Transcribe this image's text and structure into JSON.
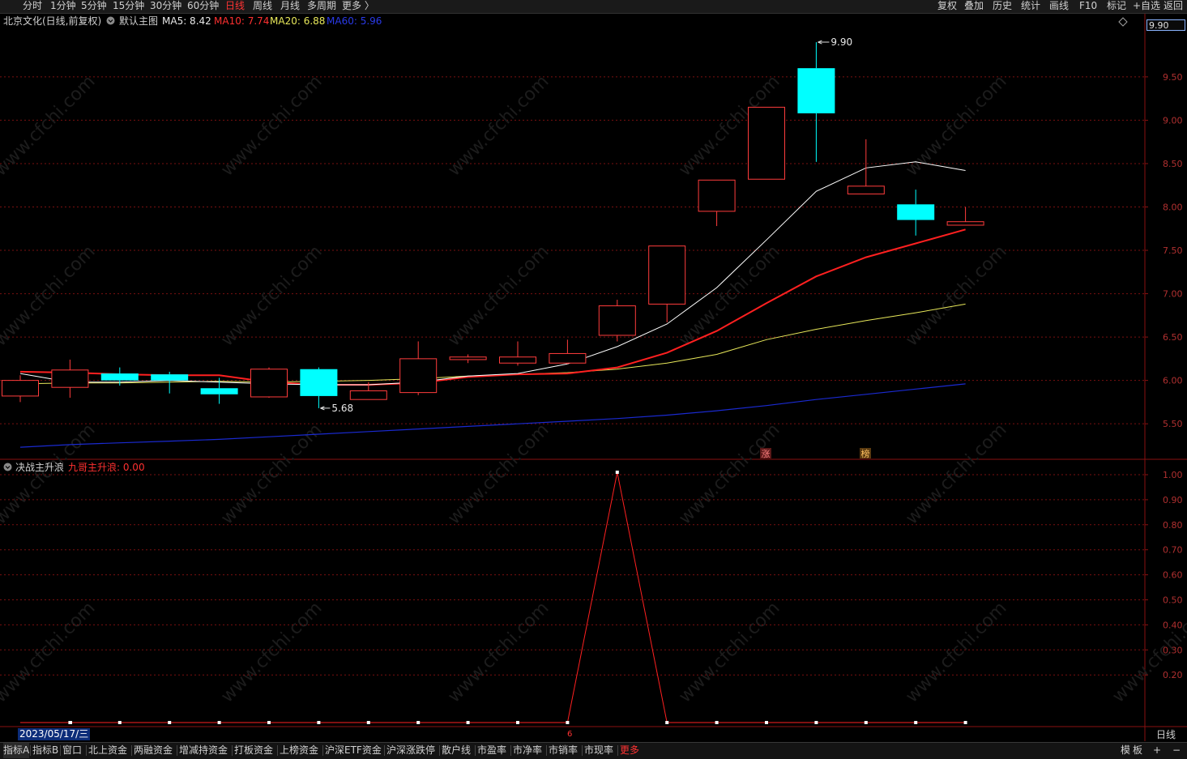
{
  "topbar": {
    "periods": [
      "分时",
      "1分钟",
      "5分钟",
      "15分钟",
      "30分钟",
      "60分钟",
      "日线",
      "周线",
      "月线",
      "多周期",
      "更多 〉"
    ],
    "active_period": "日线",
    "tools": [
      "复权",
      "叠加",
      "历史",
      "统计",
      "画线",
      "F10",
      "标记",
      "+自选",
      "返回"
    ]
  },
  "main_chart": {
    "title": "北京文化(日线,前复权)",
    "template": "默认主图",
    "ma5": "MA5: 8.42",
    "ma10": "MA10: 7.74",
    "ma20": "MA20: 6.88",
    "ma60": "MA60: 5.96",
    "current_price_tag": "9.90",
    "high_label": "9.90",
    "low_label": "5.68",
    "marker_zhang": "涨",
    "marker_bang": "榜",
    "y_ticks": [
      "9.50",
      "9.00",
      "8.50",
      "8.00",
      "7.50",
      "7.00",
      "6.50",
      "6.00",
      "5.50"
    ]
  },
  "indicator": {
    "name": "决战主升浪",
    "value_label": "九哥主升浪: 0.00",
    "y_ticks": [
      "1.00",
      "0.90",
      "0.80",
      "0.70",
      "0.60",
      "0.50",
      "0.40",
      "0.30",
      "0.20"
    ]
  },
  "footer": {
    "date_cursor": "2023/05/17/三",
    "date_marker": "6",
    "period_label": "日线"
  },
  "bottom_tabs": [
    "指标A",
    "指标B",
    "窗口",
    "北上资金",
    "两融资金",
    "增减持资金",
    "打板资金",
    "上榜资金",
    "沪深ETF资金",
    "沪深涨跌停",
    "散户线",
    "市盈率",
    "市净率",
    "市销率",
    "市现率",
    "更多"
  ],
  "bottom_right": [
    "模",
    "板",
    "+",
    "−"
  ],
  "watermark": "www.cfchi.com",
  "colors": {
    "up": "#ff3c3c",
    "down": "#00ffff",
    "ma5": "#ffffff",
    "ma10": "#ff2020",
    "ma20": "#e8e85a",
    "ma60": "#1a2ad0",
    "grid": "#7a1010"
  },
  "chart_data": {
    "type": "candlestick",
    "title": "北京文化(日线,前复权)",
    "ylim": [
      5.1,
      10.05
    ],
    "candles": [
      {
        "open": 5.82,
        "close": 6.0,
        "high": 6.06,
        "low": 5.75
      },
      {
        "open": 5.92,
        "close": 6.12,
        "high": 6.24,
        "low": 5.8
      },
      {
        "open": 6.08,
        "close": 6.0,
        "high": 6.15,
        "low": 5.94
      },
      {
        "open": 6.07,
        "close": 6.0,
        "high": 6.1,
        "low": 5.85
      },
      {
        "open": 5.91,
        "close": 5.84,
        "high": 6.03,
        "low": 5.73
      },
      {
        "open": 5.81,
        "close": 6.13,
        "high": 6.15,
        "low": 5.8
      },
      {
        "open": 6.13,
        "close": 5.82,
        "high": 6.15,
        "low": 5.68
      },
      {
        "open": 5.78,
        "close": 5.88,
        "high": 5.98,
        "low": 5.78
      },
      {
        "open": 5.86,
        "close": 6.25,
        "high": 6.45,
        "low": 5.83
      },
      {
        "open": 6.24,
        "close": 6.27,
        "high": 6.3,
        "low": 6.2
      },
      {
        "open": 6.2,
        "close": 6.27,
        "high": 6.45,
        "low": 6.17
      },
      {
        "open": 6.2,
        "close": 6.31,
        "high": 6.47,
        "low": 6.19
      },
      {
        "open": 6.52,
        "close": 6.86,
        "high": 6.93,
        "low": 6.45
      },
      {
        "open": 6.88,
        "close": 7.55,
        "high": 7.55,
        "low": 6.67
      },
      {
        "open": 7.95,
        "close": 8.31,
        "high": 8.31,
        "low": 7.78
      },
      {
        "open": 8.32,
        "close": 9.15,
        "high": 9.15,
        "low": 8.32
      },
      {
        "open": 9.6,
        "close": 9.08,
        "high": 9.9,
        "low": 8.52
      },
      {
        "open": 8.15,
        "close": 8.24,
        "high": 8.78,
        "low": 8.15
      },
      {
        "open": 8.03,
        "close": 7.85,
        "high": 8.2,
        "low": 7.67
      },
      {
        "open": 7.79,
        "close": 7.83,
        "high": 8.0,
        "low": 7.79
      }
    ],
    "ma5": [
      6.08,
      5.98,
      5.98,
      6.0,
      5.98,
      5.96,
      5.95,
      5.95,
      5.98,
      6.05,
      6.08,
      6.19,
      6.39,
      6.65,
      7.07,
      7.62,
      8.18,
      8.45,
      8.52,
      8.42
    ],
    "ma10": [
      6.1,
      6.09,
      6.07,
      6.06,
      6.06,
      5.98,
      5.95,
      5.95,
      5.97,
      6.04,
      6.07,
      6.08,
      6.15,
      6.32,
      6.57,
      6.89,
      7.2,
      7.42,
      7.58,
      7.74
    ],
    "ma20": [
      5.96,
      5.97,
      5.97,
      5.98,
      5.99,
      5.98,
      5.99,
      6.0,
      6.02,
      6.05,
      6.07,
      6.09,
      6.13,
      6.2,
      6.3,
      6.47,
      6.59,
      6.69,
      6.78,
      6.88
    ],
    "ma60": [
      5.23,
      5.26,
      5.28,
      5.3,
      5.32,
      5.35,
      5.38,
      5.41,
      5.44,
      5.47,
      5.5,
      5.53,
      5.56,
      5.6,
      5.65,
      5.71,
      5.78,
      5.84,
      5.9,
      5.96
    ],
    "indicator": {
      "name": "九哥主升浪",
      "ylim": [
        0,
        1.0
      ],
      "values": [
        0,
        0,
        0,
        0,
        0,
        0,
        0,
        0,
        0,
        0,
        0,
        1,
        0,
        0,
        0,
        0,
        0,
        0,
        0
      ],
      "indicator_x_index_offset": 0
    }
  }
}
